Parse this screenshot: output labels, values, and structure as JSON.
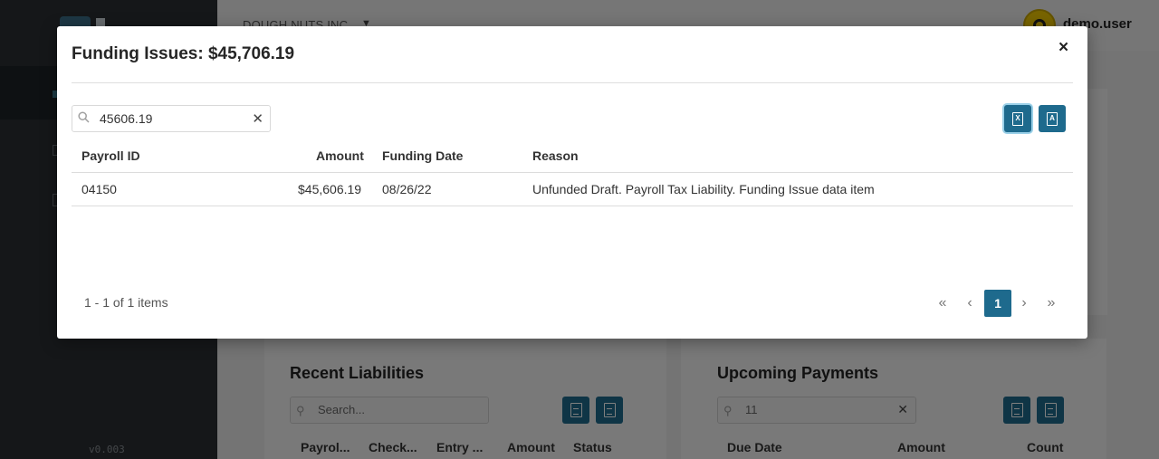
{
  "app": {
    "company": "DOUGH NUTS INC.",
    "user_name": "demo.user",
    "version": "v0.003"
  },
  "recent_liabilities": {
    "title": "Recent Liabilities",
    "search_placeholder": "Search...",
    "columns": [
      "Payrol...",
      "Check...",
      "Entry ...",
      "Amount",
      "Status"
    ]
  },
  "upcoming_payments": {
    "title": "Upcoming Payments",
    "search_value": "11",
    "columns": [
      "Due Date",
      "Amount",
      "Count"
    ]
  },
  "modal": {
    "title": "Funding Issues: $45,706.19",
    "close_label": "×",
    "search_value": "45606.19",
    "clear_label": "✕",
    "export_excel_label": "X",
    "export_pdf_label": "A",
    "columns": {
      "payroll_id": "Payroll ID",
      "amount": "Amount",
      "funding_date": "Funding Date",
      "reason": "Reason"
    },
    "rows": [
      {
        "payroll_id": "04150",
        "amount": "$45,606.19",
        "funding_date": "08/26/22",
        "reason": "Unfunded Draft. Payroll Tax Liability. Funding Issue data item"
      }
    ],
    "pager": {
      "info": "1 - 1 of 1 items",
      "first": "«",
      "prev": "‹",
      "current_page": "1",
      "next": "›",
      "last": "»"
    }
  },
  "colors": {
    "accent": "#1e6a8d",
    "sidebar": "#2b2f33",
    "avatar": "#f0c800"
  }
}
